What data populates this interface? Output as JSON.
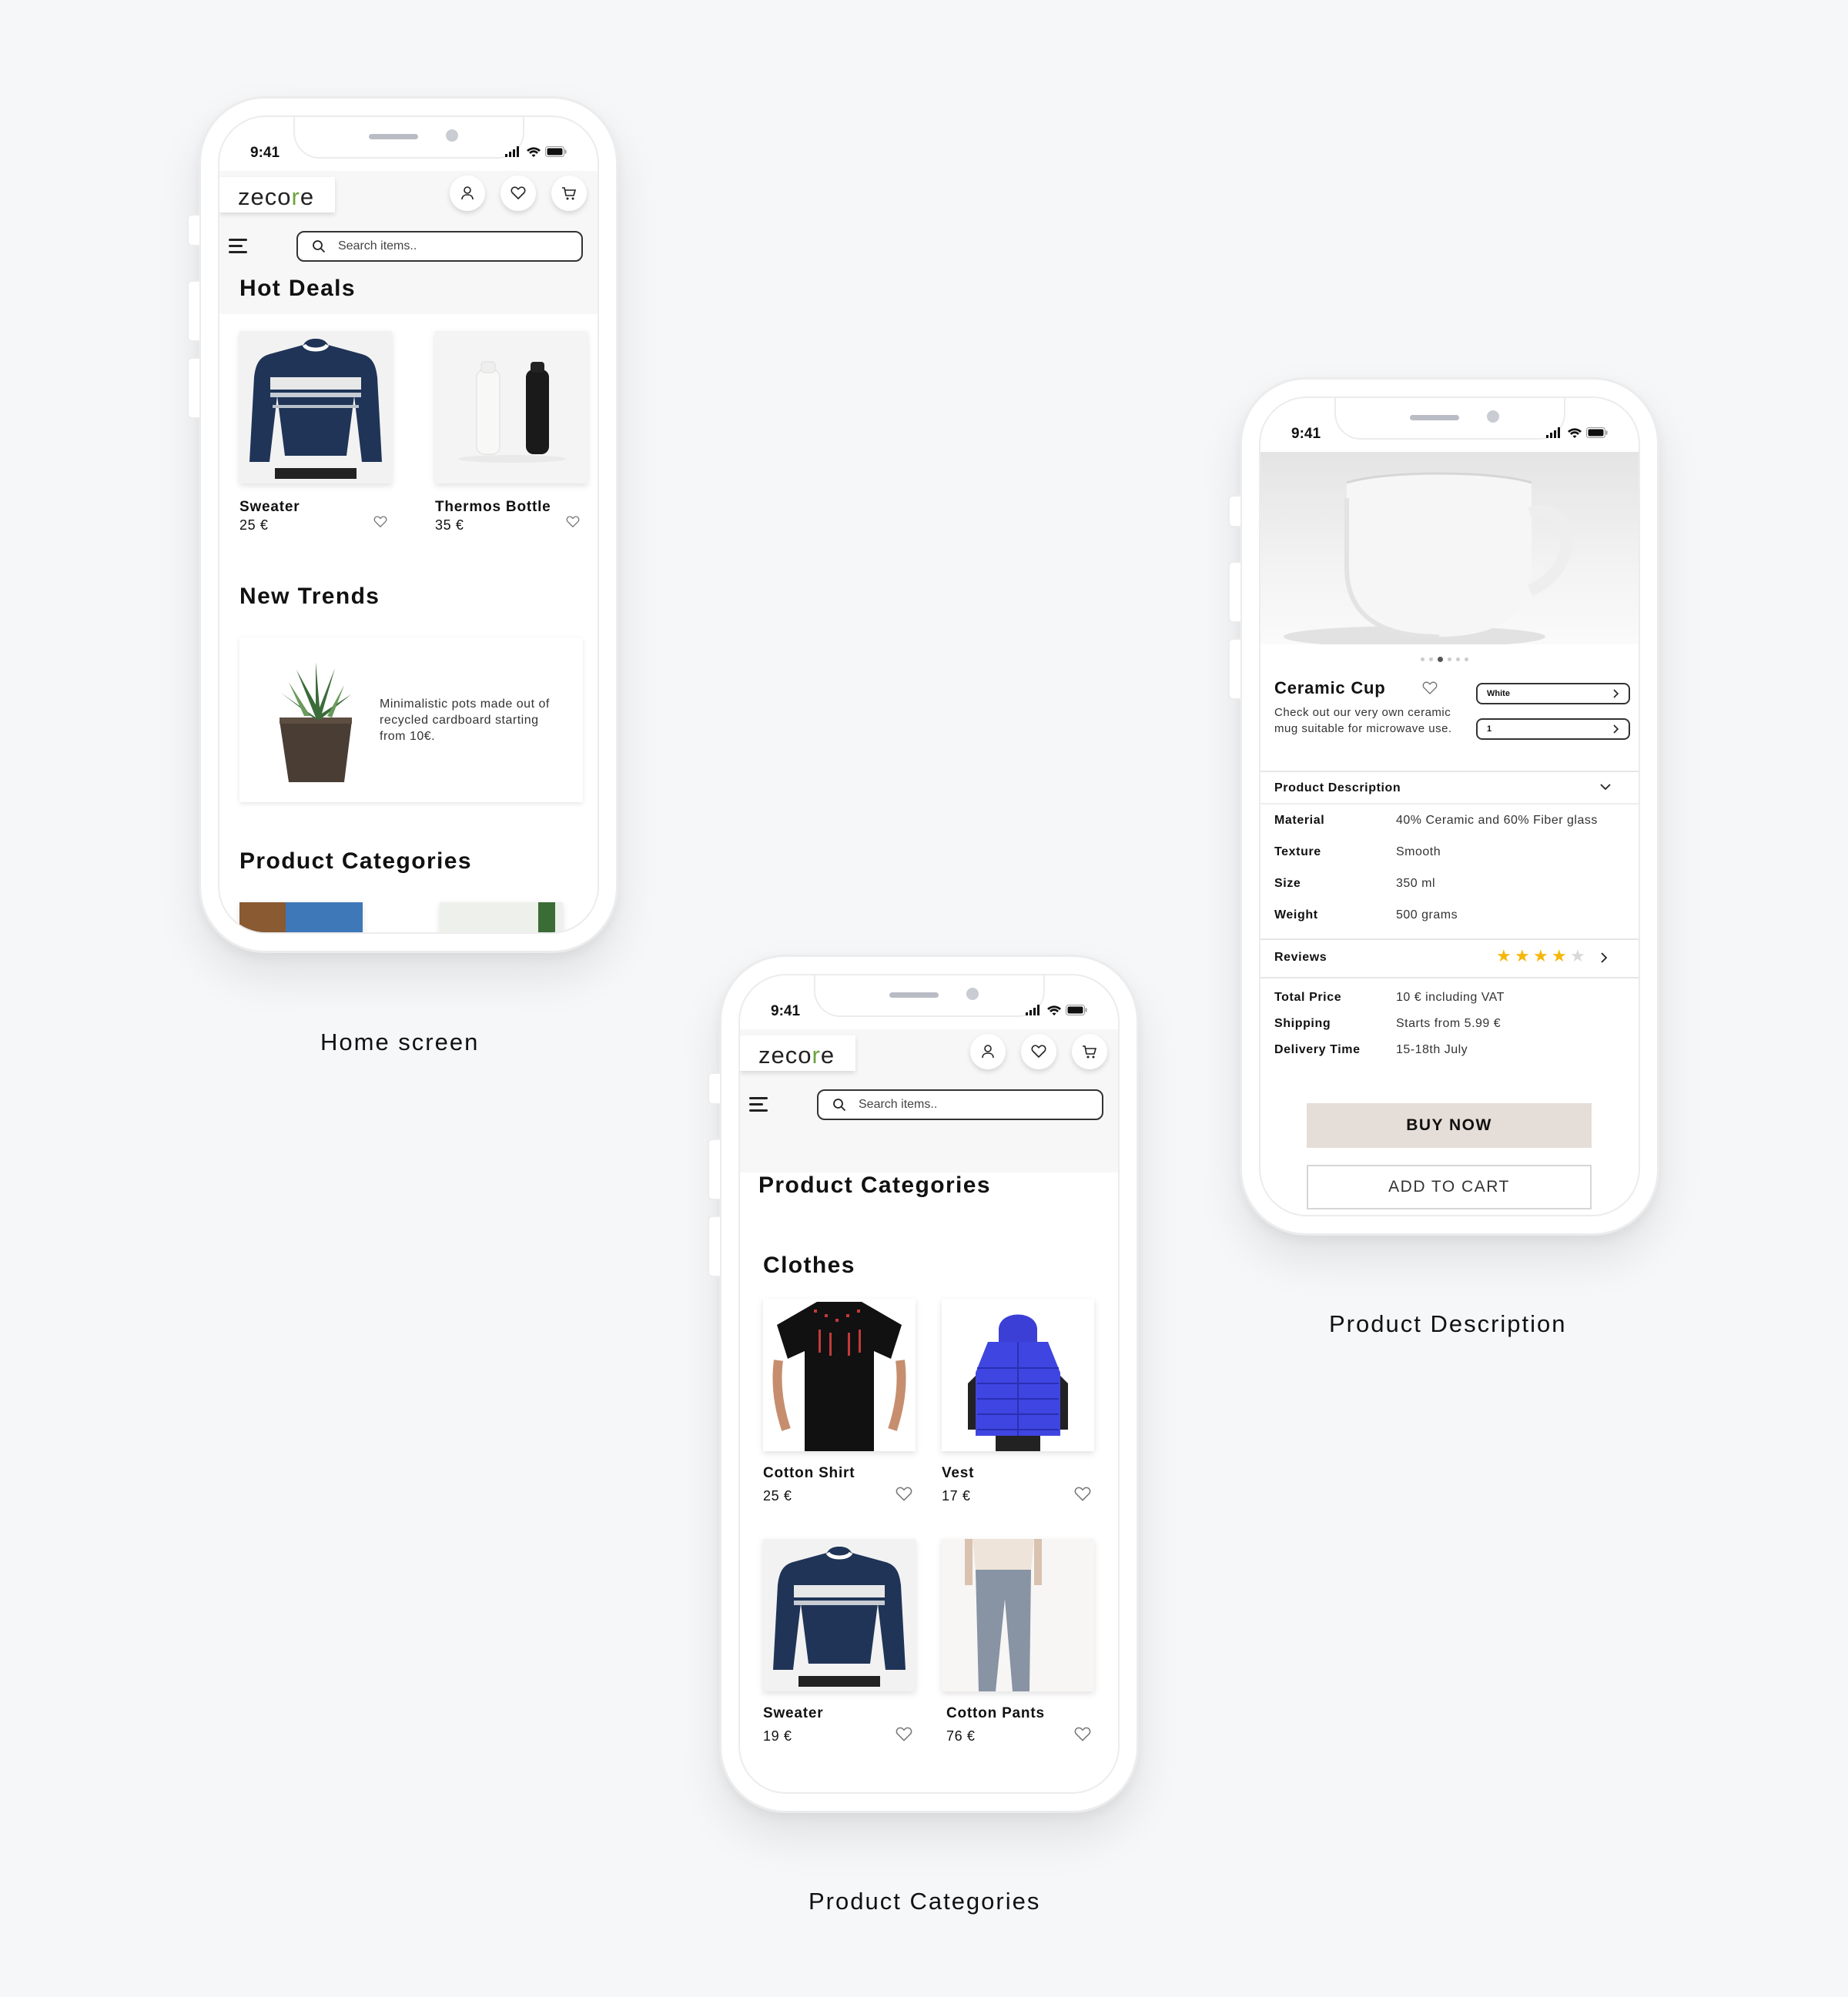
{
  "status": {
    "time": "9:41"
  },
  "app": {
    "logo_left": "zeco",
    "logo_leaf": "r",
    "logo_right": "e"
  },
  "search": {
    "placeholder": "Search items.."
  },
  "home": {
    "hot_deals_title": "Hot Deals",
    "deals": [
      {
        "name": "Sweater",
        "price": "25 €"
      },
      {
        "name": "Thermos Bottle",
        "price": "35 €"
      }
    ],
    "new_trends_title": "New Trends",
    "trend_text": "Minimalistic pots made out of recycled cardboard starting from 10€.",
    "categories_title": "Product Categories",
    "caption": "Home screen"
  },
  "categories": {
    "title": "Product Categories",
    "section": "Clothes",
    "items": [
      {
        "name": "Cotton Shirt",
        "price": "25 €"
      },
      {
        "name": "Vest",
        "price": "17 €"
      },
      {
        "name": "Sweater",
        "price": "19 €"
      },
      {
        "name": "Cotton Pants",
        "price": "76 €"
      }
    ],
    "caption": "Product Categories"
  },
  "product": {
    "name": "Ceramic Cup",
    "description": "Check out our very own ceramic mug suitable for microwave use.",
    "color_option": "White",
    "quantity_option": "1",
    "desc_header": "Product Description",
    "specs": [
      {
        "label": "Material",
        "value": "40% Ceramic and 60% Fiber glass"
      },
      {
        "label": "Texture",
        "value": "Smooth"
      },
      {
        "label": "Size",
        "value": "350 ml"
      },
      {
        "label": "Weight",
        "value": "500 grams"
      }
    ],
    "reviews_label": "Reviews",
    "rating": 4,
    "rating_max": 5,
    "pricing": [
      {
        "label": "Total Price",
        "value": "10 € including VAT"
      },
      {
        "label": "Shipping",
        "value": "Starts  from 5.99 €"
      },
      {
        "label": "Delivery Time",
        "value": "15-18th July"
      }
    ],
    "buy_now": "BUY NOW",
    "add_to_cart": "ADD TO CART",
    "caption": "Product Description",
    "carousel_dots": 6,
    "carousel_active": 3
  },
  "colors": {
    "star": "#f5b70a",
    "star_empty": "#d8d8d8",
    "buy_bg": "#e5ddd8",
    "leaf": "#6aa33c"
  },
  "icons": [
    "user-icon",
    "heart-icon",
    "cart-icon",
    "search-icon",
    "menu-icon",
    "chevron-right-icon",
    "chevron-down-icon",
    "signal-icon",
    "wifi-icon",
    "battery-icon"
  ]
}
